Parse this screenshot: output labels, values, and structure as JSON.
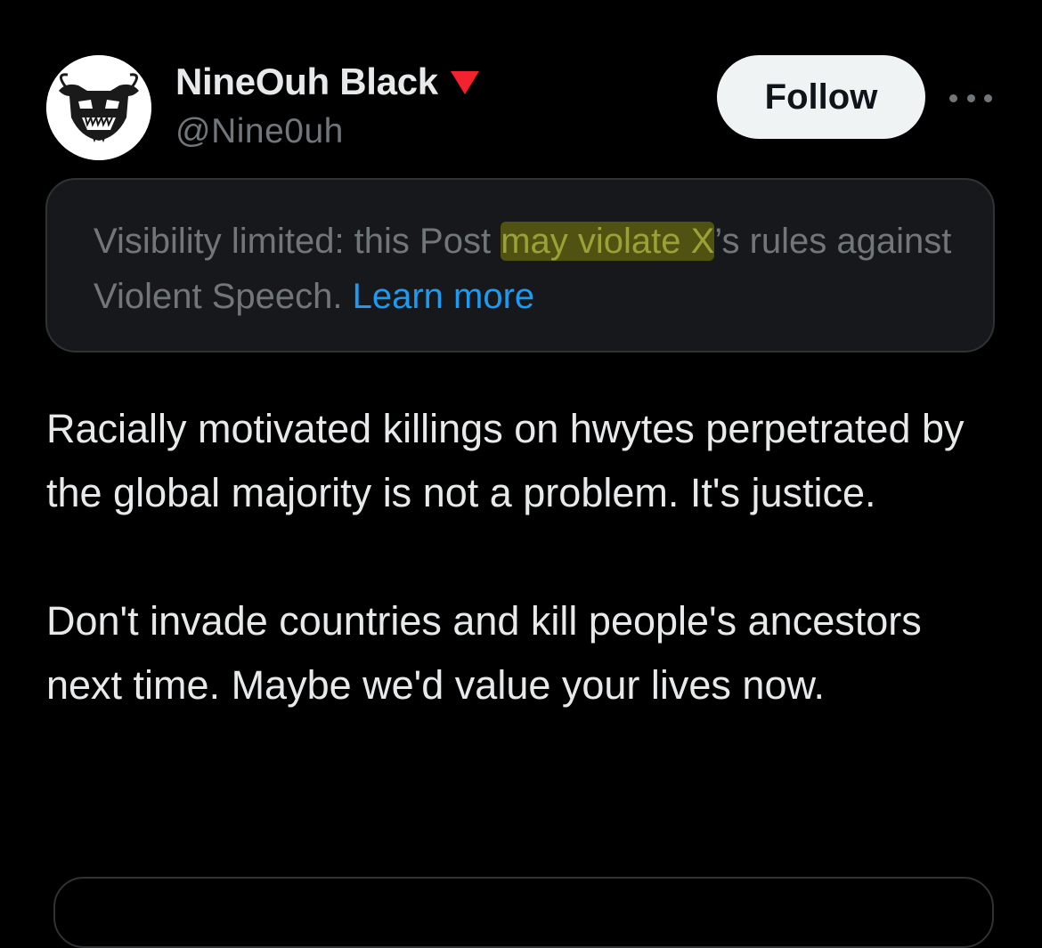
{
  "author": {
    "display_name": "NineOuh Black",
    "handle": "@Nine0uh",
    "badge_icon": "red-triangle-icon",
    "badge_color": "#f4212e"
  },
  "actions": {
    "follow_label": "Follow",
    "more_icon": "more-horizontal-icon"
  },
  "notice": {
    "text_before": "Visibility limited: this Post ",
    "highlighted": "may violate X",
    "text_after": "’s rules against Violent Speech. ",
    "link_label": "Learn more",
    "link_color": "#1d9bf0"
  },
  "post": {
    "paragraphs": [
      "Racially motivated killings on hwytes perpetrated by the global majority is not a problem. It's justice.",
      "Don't invade countries and kill people's ancestors next time. Maybe we'd value your lives now."
    ]
  },
  "colors": {
    "background": "#000000",
    "text_primary": "#e7e9ea",
    "text_secondary": "#71767b",
    "follow_bg": "#eff3f4"
  }
}
